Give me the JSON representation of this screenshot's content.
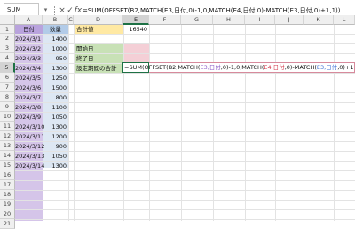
{
  "formula_bar": {
    "name_box": "SUM",
    "cancel_glyph": "×",
    "enter_glyph": "✓",
    "fx_label": "fx",
    "formula": "=SUM(OFFSET(B2,MATCH(E3,日付,0)-1,0,MATCH(E4,日付,0)-MATCH(E3,日付,0)+1,1))"
  },
  "columns": [
    "A",
    "B",
    "C",
    "D",
    "E",
    "F",
    "G",
    "H",
    "I",
    "J",
    "K",
    "L"
  ],
  "rows": [
    "1",
    "2",
    "3",
    "4",
    "5",
    "6",
    "7",
    "8",
    "9",
    "10",
    "11",
    "12",
    "13",
    "14",
    "15",
    "16",
    "17",
    "18",
    "19",
    "20",
    "21",
    "22"
  ],
  "headers": {
    "date": "日付",
    "qty": "数量"
  },
  "data_rows": [
    {
      "date": "2024/3/1",
      "qty": "1400"
    },
    {
      "date": "2024/3/2",
      "qty": "1000"
    },
    {
      "date": "2024/3/3",
      "qty": "950"
    },
    {
      "date": "2024/3/4",
      "qty": "1300"
    },
    {
      "date": "2024/3/5",
      "qty": "1250"
    },
    {
      "date": "2024/3/6",
      "qty": "1500"
    },
    {
      "date": "2024/3/7",
      "qty": "800"
    },
    {
      "date": "2024/3/8",
      "qty": "1100"
    },
    {
      "date": "2024/3/9",
      "qty": "1050"
    },
    {
      "date": "2024/3/10",
      "qty": "1300"
    },
    {
      "date": "2024/3/11",
      "qty": "1200"
    },
    {
      "date": "2024/3/12",
      "qty": "900"
    },
    {
      "date": "2024/3/13",
      "qty": "1050"
    },
    {
      "date": "2024/3/14",
      "qty": "1300"
    }
  ],
  "labels": {
    "total": "合計値",
    "total_value": "16540",
    "start_date": "開始日",
    "end_date": "終了日",
    "range_total": "設定期間の合計"
  },
  "edit_formula": {
    "p1": "=SUM(OFFSET(B2,MATCH(",
    "r1": "E3,日付",
    "p2": ",0)-1,0,MATCH(",
    "r2": "E4,日付",
    "p3": ",0)-MATCH(",
    "r3": "E3,日付",
    "p4": ",0)+1,1)",
    "p5": ")"
  },
  "colors": {
    "selection": "#1e7145",
    "col_a_fill": "#d5c5e9",
    "col_b_fill": "#dde7f3",
    "label_fill": "#c8e1b6",
    "total_fill": "#ffe9a3"
  }
}
